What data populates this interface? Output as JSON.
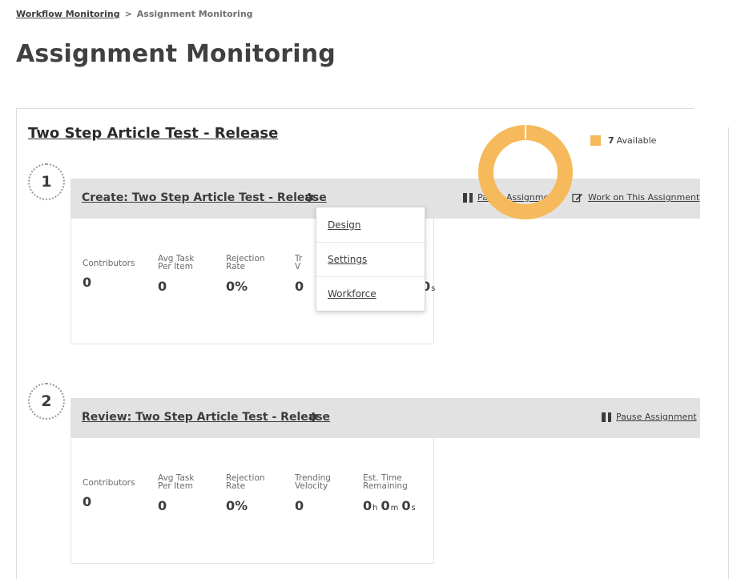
{
  "breadcrumb": {
    "parent": "Workflow Monitoring",
    "separator": ">",
    "current": "Assignment Monitoring"
  },
  "page": {
    "title": "Assignment Monitoring"
  },
  "workflow": {
    "title": "Two Step Article Test - Release"
  },
  "icons": {
    "gear": "gear-icon",
    "pause": "pause-icon",
    "edit": "edit-icon"
  },
  "assignments": [
    {
      "step": "1",
      "name": "Create: Two Step Article Test - Release",
      "actions": {
        "pause": "Pause Assignment",
        "work": "Work on This Assignment"
      },
      "stats": {
        "contributors_label": "Contributors",
        "contributors_value": "0",
        "avg_label_1": "Avg Task",
        "avg_label_2": "Per Item",
        "avg_value": "0",
        "rejection_label_1": "Rejection",
        "rejection_label_2": "Rate",
        "rejection_value": "0%",
        "trending_label_1": "Tr",
        "trending_label_2": "V",
        "trending_value": "0",
        "time_s": "0",
        "time_s_unit": "s"
      },
      "chart_data": {
        "type": "pie",
        "categories": [
          "Available"
        ],
        "values": [
          7
        ],
        "legend": [
          {
            "count": "7",
            "label": "Available"
          }
        ],
        "colors": {
          "Available": "#f6b95b"
        }
      }
    },
    {
      "step": "2",
      "name": "Review: Two Step Article Test - Release",
      "actions": {
        "pause": "Pause Assignment"
      },
      "stats": {
        "contributors_label": "Contributors",
        "contributors_value": "0",
        "avg_label_1": "Avg Task",
        "avg_label_2": "Per Item",
        "avg_value": "0",
        "rejection_label_1": "Rejection",
        "rejection_label_2": "Rate",
        "rejection_value": "0%",
        "trending_label_1": "Trending",
        "trending_label_2": "Velocity",
        "trending_value": "0",
        "time_label_1": "Est. Time",
        "time_label_2": "Remaining",
        "time_h": "0",
        "time_h_unit": "h",
        "time_m": "0",
        "time_m_unit": "m",
        "time_s": "0",
        "time_s_unit": "s"
      }
    }
  ],
  "dropdown": {
    "items": [
      {
        "label": "Design"
      },
      {
        "label": "Settings"
      },
      {
        "label": "Workforce"
      }
    ]
  }
}
